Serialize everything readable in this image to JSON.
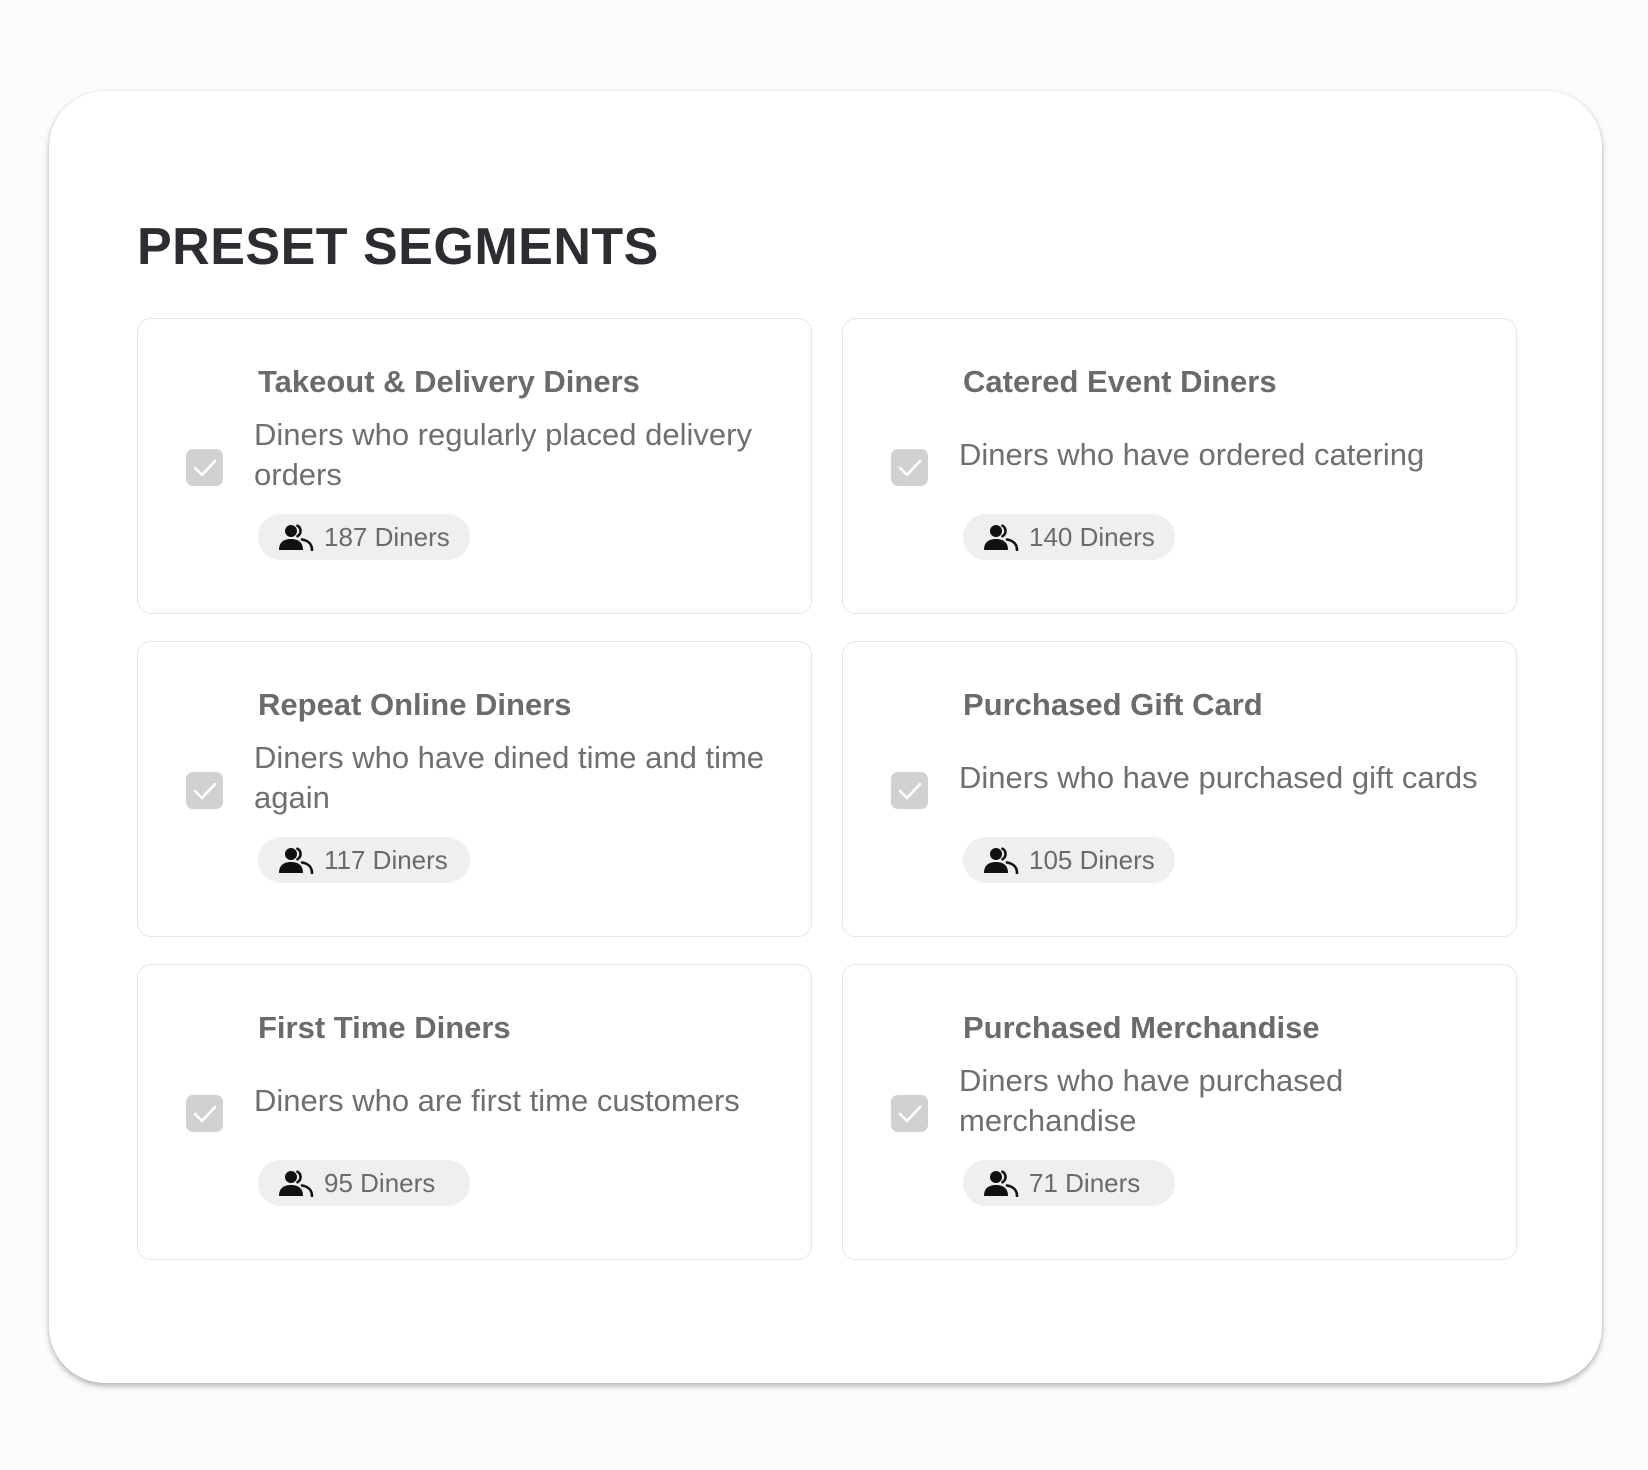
{
  "page": {
    "title": "PRESET SEGMENTS"
  },
  "segments": [
    {
      "title": "Takeout & Delivery Diners",
      "description": "Diners who regularly placed delivery orders",
      "count": "187 Diners",
      "checked": true
    },
    {
      "title": "Catered Event Diners",
      "description": "Diners who have ordered catering",
      "count": "140 Diners",
      "checked": true
    },
    {
      "title": "Repeat Online Diners",
      "description": "Diners who have dined time and time again",
      "count": "117 Diners",
      "checked": true
    },
    {
      "title": "Purchased Gift Card",
      "description": "Diners who have purchased gift cards",
      "count": "105 Diners",
      "checked": true
    },
    {
      "title": "First Time Diners",
      "description": "Diners who are first time customers",
      "count": "95 Diners",
      "checked": true
    },
    {
      "title": "Purchased Merchandise",
      "description": "Diners who have purchased merchandise",
      "count": "71 Diners",
      "checked": true
    }
  ],
  "icons": {
    "checkbox": "checkmark-icon",
    "count": "people-icon"
  },
  "colors": {
    "heading": "#2b2d31",
    "card_text": "#6b6b6b",
    "checkbox_fill": "#d1d1d1",
    "badge_fill": "#efefef"
  }
}
